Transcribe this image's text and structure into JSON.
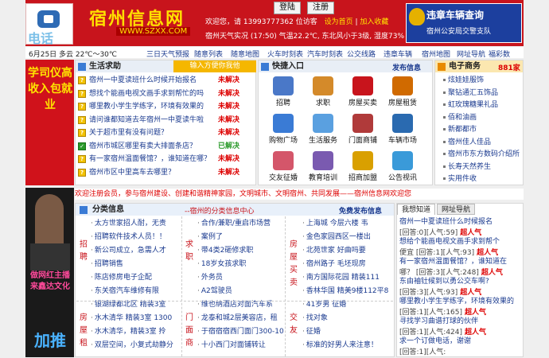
{
  "header": {
    "phone_sign": "电话",
    "title": "宿州信息网",
    "url": "WWW.SZXX.COM",
    "info_line1": "欢迎您，请 13993777362 位访客",
    "info_line2": "宿州天气实况 (17:50) 气温22.2℃, 东北风小于3级, 湿度73%",
    "login_button": "登陆",
    "register_button": "注册",
    "set_home_link": "设为首页",
    "add_fav_link": "加入收藏",
    "police_title": "违章车辆查询",
    "police_sub": "宿州公安局交警支队"
  },
  "nav": {
    "date_weather": "6月25日 多云 22℃～30℃",
    "links": [
      "三日天气预报",
      "随意列表",
      "随意地图",
      "火车时刻表",
      "汽车时刻表",
      "公交线路",
      "违章车辆",
      "宿州地图",
      "网址导航",
      "福彩数"
    ]
  },
  "left_ad": {
    "top_text": "学司仪高收入包就业",
    "bottom_text": "做网红主播来鑫达文化",
    "promo": "加推"
  },
  "life_help": {
    "title": "生活求助",
    "subtitle": "输入方便你我他",
    "items": [
      {
        "text": "宿州一中夏读班什么时候开始报名",
        "status": "未解决"
      },
      {
        "text": "想找个能画电视文画手求到帮忙的吗",
        "status": "未解决"
      },
      {
        "text": "哪里教小学生学练字，环境有效果的",
        "status": "未解决"
      },
      {
        "text": "请问谁都知道去年宿州一中夏读牛啦",
        "status": "未解决"
      },
      {
        "text": "关于超市里有没有问题？",
        "status": "未解决"
      },
      {
        "text": "宿州市城区哪里有卖大排面条店？",
        "status": "已解决"
      },
      {
        "text": "有一家宿州温面餐馆？，谁知道在哪？",
        "status": "未解决"
      },
      {
        "text": "宿州市区中里高车去哪里？",
        "status": "未解决"
      }
    ]
  },
  "quick": {
    "title": "快捷入口",
    "publish": "发布信息",
    "items": [
      "招聘",
      "求职",
      "房屋买卖",
      "房屋租赁",
      "购物广场",
      "生活服务",
      "门面商铺",
      "车辆市场",
      "交友征婚",
      "教育培训",
      "招商加盟",
      "公告视讯"
    ]
  },
  "business": {
    "title": "电子商务",
    "count": "881家",
    "links": [
      "炫娃娃服饰",
      "聚钻通汇五饰品",
      "虹玫瑰糖果礼品",
      "佰和油画",
      "新都都市",
      "宿州佳人佳品",
      "宿州市东方数码介绍所",
      "长寿天然养生",
      "实用件收"
    ]
  },
  "marquee": "欢迎注册会员，参与宿州建设、创建和谐精神家园，文明城市、文明宿州、共同发展——宿州信息网欢迎您",
  "classified": {
    "title": "分类信息",
    "center": "--宿州的分类信息中心",
    "free_publish": "免费发布信息",
    "tags": [
      {
        "label": "招聘",
        "col": 0,
        "row": 0
      },
      {
        "label": "求职",
        "col": 1,
        "row": 0
      },
      {
        "label": "房屋买卖",
        "col": 2,
        "row": 0
      },
      {
        "label": "房屋租",
        "col": 0,
        "row": 1
      },
      {
        "label": "门面商",
        "col": 1,
        "row": 1
      },
      {
        "label": "交友",
        "col": 2,
        "row": 1
      }
    ],
    "col1": [
      "太方世家招人耐，无责",
      "招聘软件技术人员！！",
      "新公司成立，急需人才",
      "招聘销售",
      "陈店修房电子企配",
      "东关宿汽车维修有限",
      "银湖绿都北区 精装3室",
      "水木清华 精装3室 1300",
      "水木清华，精装3室 拎",
      "双层空间，小复式劫静分"
    ],
    "col2": [
      "合作/兼职/重启市场营",
      "案例了",
      "带4类2砸修求职",
      "18岁女孩求职",
      "外务员",
      "A2驾驶员",
      "维也纳酒店对面汽车系",
      "龙泰和城2层美容店，租",
      "于宿宿宿西门面门300-10",
      "十小西门对面铺转让"
    ],
    "col3": [
      "上海城 今层六楼 韦",
      "金色家园西区一楼出",
      "北苑世家 好曲吗要",
      "宿州路子 毛坯现房",
      "南方国际花园 精装111",
      "香林华国 精美9楼112平80",
      "41岁男 征婚",
      "找对象",
      "征婚",
      "标准的好男人来注意！"
    ]
  },
  "qa_tabs": {
    "tab1": "我想知道",
    "tab2": "网址导航"
  },
  "qa": [
    {
      "q": "宿州一中夏读班什么时候报名",
      "n": "[回答:0][人气:59]",
      "r": "超人气"
    },
    {
      "q": "想给个能画电视文画手求到帮个",
      "n": "便宜 [回答:1][人气:93]",
      "r": "超人气"
    },
    {
      "q": "有一家宿州温面餐馆？，谁知道在",
      "n": "哪？ [回答:3][人气:248]",
      "r": "超人气"
    },
    {
      "q": "东由袖钍候到以勇公交车啊?",
      "n": "[回答:3][人气:93]",
      "r": "超人气"
    },
    {
      "q": "哪里教小学生学练字，环境有效果的",
      "n": "[回答:1][人气:165]",
      "r": "超人气"
    },
    {
      "q": "寻找学习曲谱打球的伙伴",
      "n": "[回答:1][人气:424]",
      "r": "超人气"
    },
    {
      "q": "求一个订做电话，谢谢",
      "n": "[回答:1][人气:",
      "r": ""
    }
  ]
}
